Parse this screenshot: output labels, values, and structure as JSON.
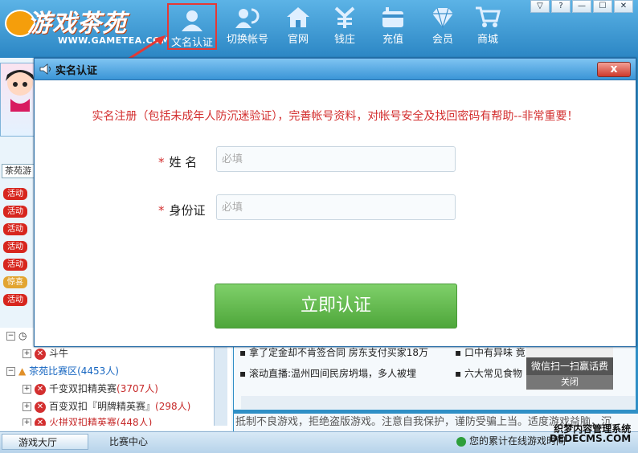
{
  "app": {
    "logo_cn": "游戏茶苑",
    "logo_url": "WWW.GAMETEA.COM"
  },
  "nav": {
    "items": [
      {
        "label": "文名认证",
        "icon": "user-id-icon"
      },
      {
        "label": "切换帐号",
        "icon": "switch-account-icon"
      },
      {
        "label": "官网",
        "icon": "home-icon"
      },
      {
        "label": "钱庄",
        "icon": "bank-icon"
      },
      {
        "label": "充值",
        "icon": "recharge-icon"
      },
      {
        "label": "会员",
        "icon": "diamond-icon"
      },
      {
        "label": "商城",
        "icon": "cart-icon"
      }
    ],
    "window_controls": [
      "▽",
      "?",
      "—",
      "☐",
      "✕"
    ]
  },
  "left": {
    "tab_label": "茶苑游",
    "tags": [
      "活动",
      "活动",
      "活动",
      "活动",
      "活动",
      "惊喜",
      "活动"
    ],
    "tree": [
      {
        "label": "斗牛",
        "count": ""
      },
      {
        "label": "茶苑比赛区",
        "count": "(4453人)"
      },
      {
        "label": "千变双扣精英赛",
        "count": "(3707人)"
      },
      {
        "label": "百变双扣『明牌精英赛』",
        "count": "(298人)"
      },
      {
        "label": "火拼双扣精英赛",
        "count": "(448人)"
      }
    ]
  },
  "news": {
    "items": [
      "拿了定金却不肯签合同 房东支付买家18万",
      "滚动直播:温州四间民房坍塌，多人被埋",
      "口中有异味 竟",
      "六大常见食物"
    ],
    "qr_text": "微信扫一扫赢话费",
    "qr_close": "关闭"
  },
  "marquee": "抵制不良游戏，拒绝盗版游戏。注意自我保护，谨防受骗上当。适度游戏益脑，沉",
  "statusbar": {
    "hall": "游戏大厅",
    "match": "比赛中心",
    "status": "您的累计在线游戏时间",
    "watermark_line1": "织梦内容管理系统",
    "watermark_line2": "DEDECMS.COM"
  },
  "dialog": {
    "title": "实名认证",
    "close_label": "x",
    "notice": "实名注册（包括未成年人防沉迷验证），完善帐号资料，对帐号安全及找回密码有帮助--非常重要！",
    "fields": {
      "name_label": "姓 名",
      "name_placeholder": "必填",
      "id_label": "身份证",
      "id_placeholder": "必填",
      "required_mark": "*"
    },
    "submit_label": "立即认证"
  },
  "colors": {
    "accent": "#2b86c4",
    "notice_red": "#d32f2f",
    "submit_green": "#5cb848"
  }
}
